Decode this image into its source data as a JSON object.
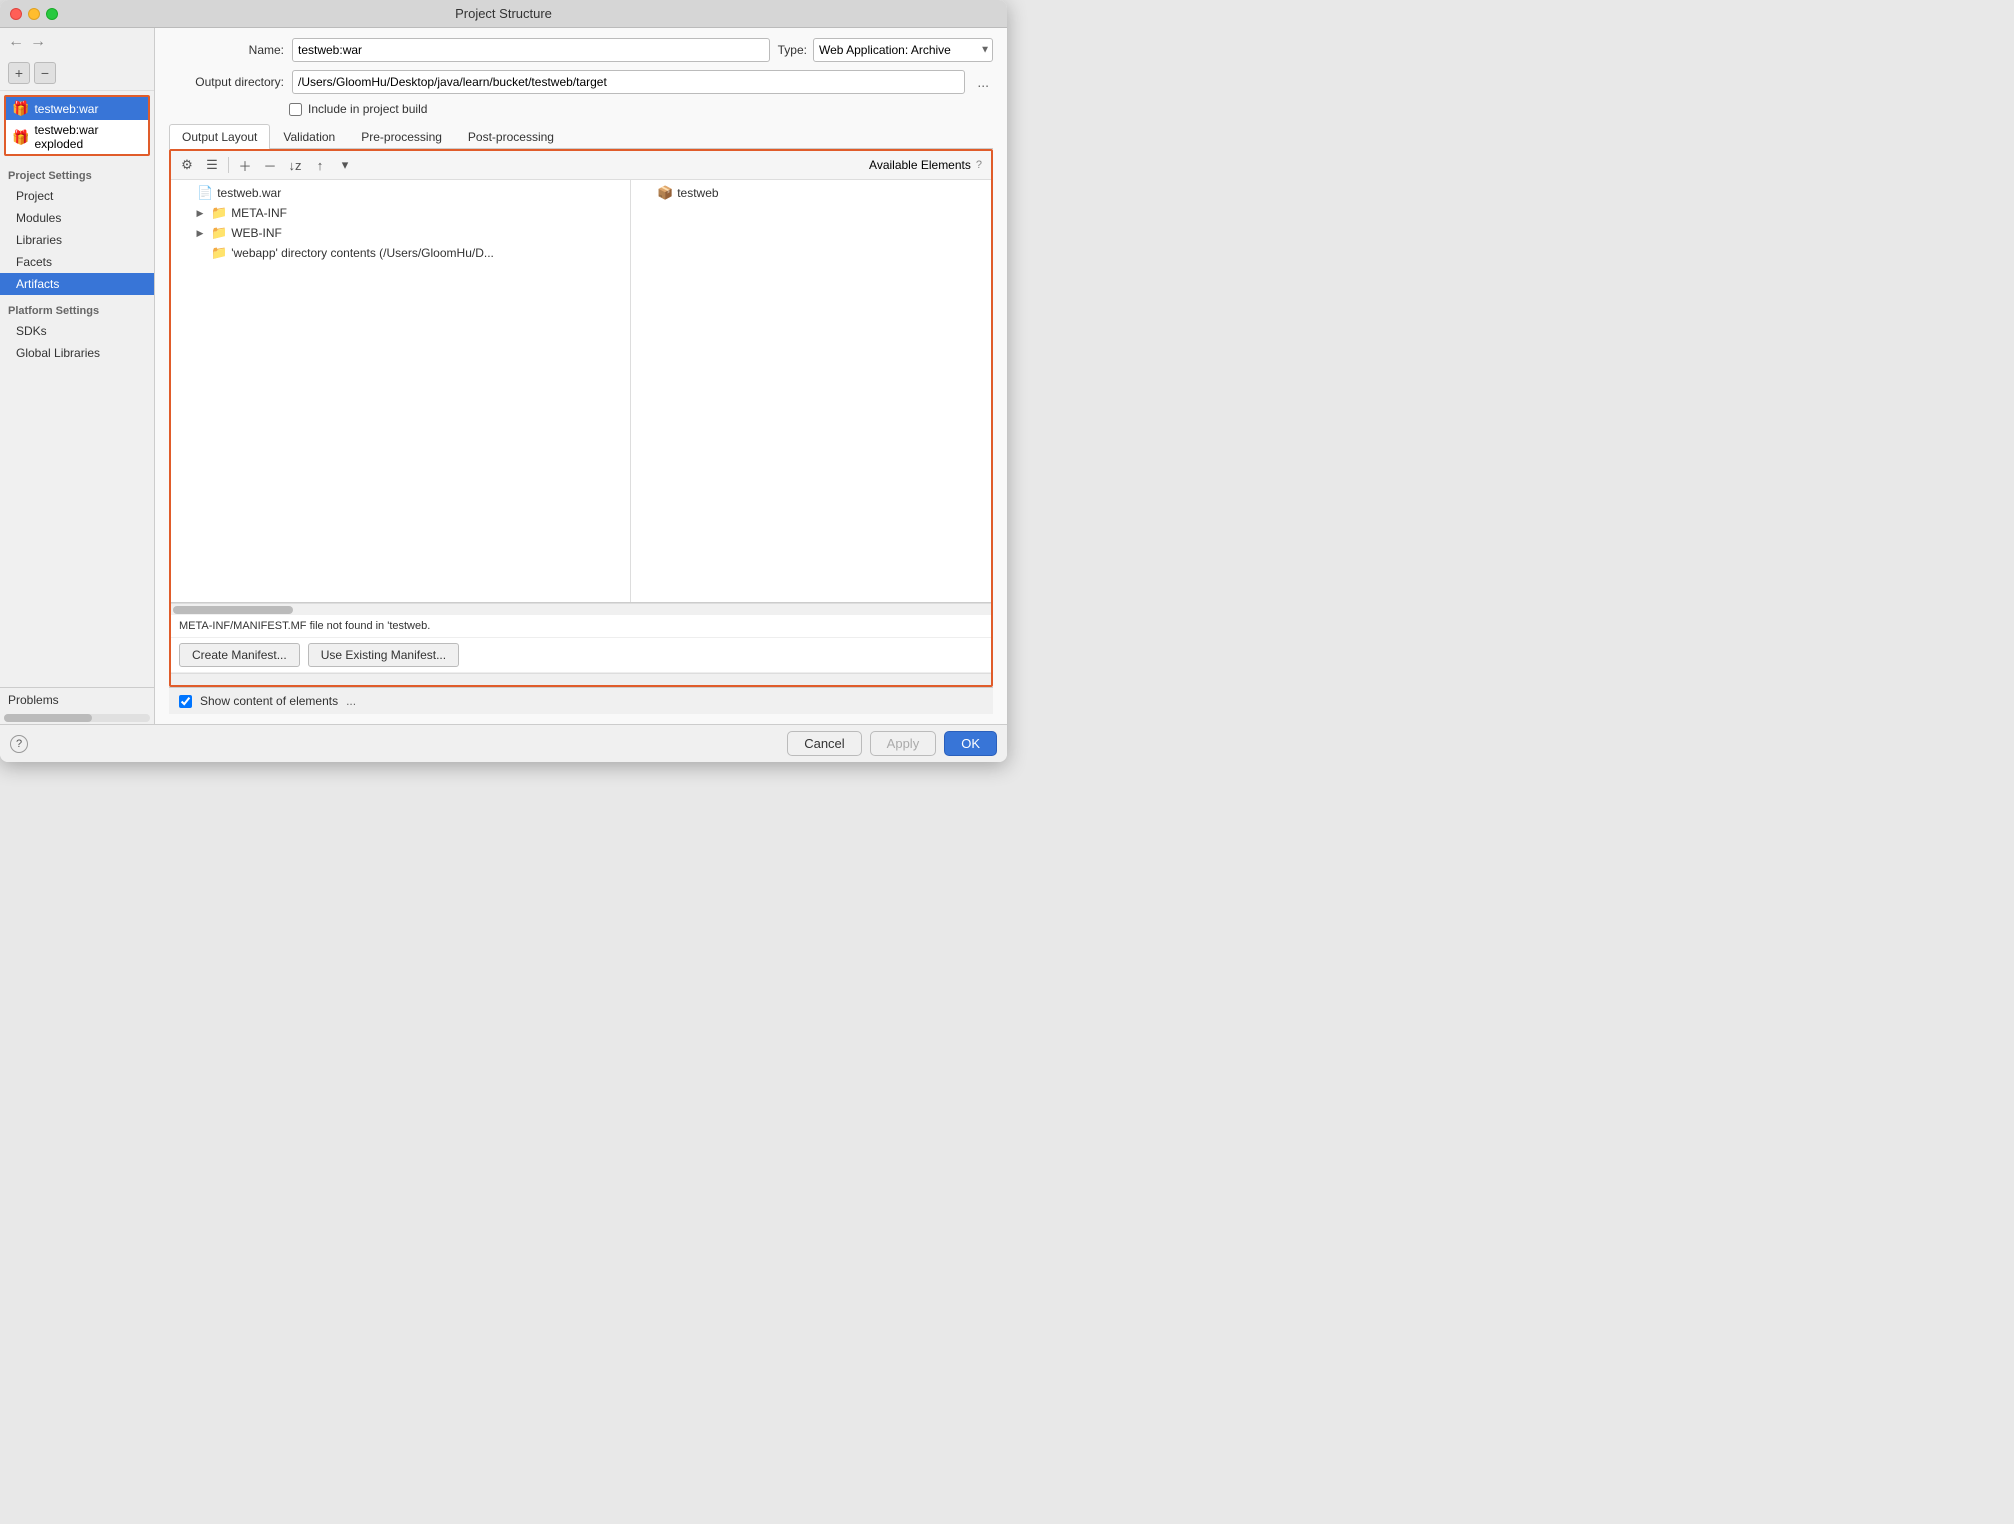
{
  "window": {
    "title": "Project Structure"
  },
  "sidebar": {
    "nav_arrows": {
      "back": "←",
      "forward": "→"
    },
    "project_settings_label": "Project Settings",
    "nav_items": [
      {
        "id": "project",
        "label": "Project"
      },
      {
        "id": "modules",
        "label": "Modules"
      },
      {
        "id": "libraries",
        "label": "Libraries"
      },
      {
        "id": "facets",
        "label": "Facets"
      },
      {
        "id": "artifacts",
        "label": "Artifacts",
        "active": true
      }
    ],
    "platform_settings_label": "Platform Settings",
    "platform_nav_items": [
      {
        "id": "sdks",
        "label": "SDKs"
      },
      {
        "id": "global-libraries",
        "label": "Global Libraries"
      }
    ],
    "problems_label": "Problems",
    "artifacts": [
      {
        "id": "testweb-war",
        "label": "testweb:war",
        "active": true
      },
      {
        "id": "testweb-war-exploded",
        "label": "testweb:war exploded"
      }
    ],
    "add_btn": "+",
    "remove_btn": "−"
  },
  "content": {
    "name_label": "Name:",
    "name_value": "testweb:war",
    "type_label": "Type:",
    "type_value": "Web Application: Archive",
    "output_dir_label": "Output directory:",
    "output_dir_value": "/Users/GloomHu/Desktop/java/learn/bucket/testweb/target",
    "browse_btn": "...",
    "include_in_build_label": "Include in project build",
    "tabs": [
      {
        "id": "output-layout",
        "label": "Output Layout",
        "active": true
      },
      {
        "id": "validation",
        "label": "Validation"
      },
      {
        "id": "pre-processing",
        "label": "Pre-processing"
      },
      {
        "id": "post-processing",
        "label": "Post-processing"
      }
    ],
    "layout_toolbar": {
      "btn1": "⚙",
      "btn2": "☰",
      "btn3": "+",
      "btn4": "−",
      "btn5": "↓z",
      "btn6": "↑",
      "btn7": "▾"
    },
    "available_elements_label": "Available Elements",
    "available_help": "?",
    "tree": [
      {
        "level": 0,
        "icon": "📄",
        "label": "testweb.war",
        "toggle": ""
      },
      {
        "level": 1,
        "icon": "📁",
        "label": "META-INF",
        "toggle": "▶"
      },
      {
        "level": 1,
        "icon": "📁",
        "label": "WEB-INF",
        "toggle": "▶"
      },
      {
        "level": 1,
        "icon": "📁",
        "label": "'webapp' directory contents (/Users/GloomHu/D...",
        "toggle": ""
      }
    ],
    "available_tree": [
      {
        "level": 0,
        "icon": "📦",
        "label": "testweb",
        "toggle": ""
      }
    ],
    "warning_text": "META-INF/MANIFEST.MF file not found in 'testweb.",
    "create_manifest_btn": "Create Manifest...",
    "use_existing_manifest_btn": "Use Existing Manifest...",
    "show_content_label": "Show content of elements",
    "show_content_settings": "..."
  },
  "footer": {
    "help_btn": "?",
    "cancel_btn": "Cancel",
    "apply_btn": "Apply",
    "ok_btn": "OK"
  }
}
